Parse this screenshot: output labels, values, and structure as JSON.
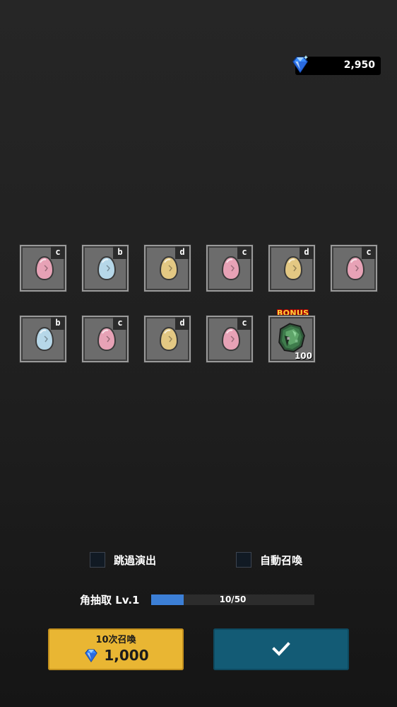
{
  "currency": {
    "amount": "2,950",
    "icon": "diamond-gem-icon"
  },
  "results": [
    {
      "grade": "c",
      "egg_color": "pink"
    },
    {
      "grade": "b",
      "egg_color": "blue"
    },
    {
      "grade": "d",
      "egg_color": "yellow"
    },
    {
      "grade": "c",
      "egg_color": "pink"
    },
    {
      "grade": "d",
      "egg_color": "yellow"
    },
    {
      "grade": "c",
      "egg_color": "pink"
    },
    {
      "grade": "b",
      "egg_color": "blue"
    },
    {
      "grade": "c",
      "egg_color": "pink"
    },
    {
      "grade": "d",
      "egg_color": "yellow"
    },
    {
      "grade": "c",
      "egg_color": "pink"
    }
  ],
  "bonus": {
    "label": "BONUS",
    "count": "100",
    "icon": "green-horn-item-icon"
  },
  "options": {
    "skip_label": "跳過演出",
    "auto_label": "自動召喚"
  },
  "level": {
    "label": "角抽取 Lv.1",
    "progress_text": "10/50",
    "current": 10,
    "max": 50
  },
  "summon_button": {
    "title": "10次召喚",
    "cost": "1,000"
  },
  "confirm_button": {
    "icon": "checkmark-icon"
  },
  "colors": {
    "egg_pink": "#e7a2b6",
    "egg_blue": "#b6d7e8",
    "egg_yellow": "#e3c883",
    "gold_button": "#e9b633",
    "teal_button": "#135b75",
    "progress_fill": "#3c7fd6"
  }
}
